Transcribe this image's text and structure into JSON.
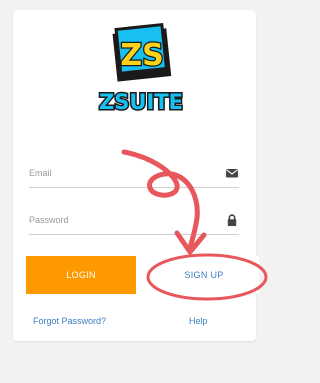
{
  "brand": {
    "logo_initials": "ZS",
    "logo_name": "ZSUITE"
  },
  "form": {
    "email_placeholder": "Email",
    "password_placeholder": "Password",
    "email_icon": "envelope-icon",
    "password_icon": "lock-icon"
  },
  "buttons": {
    "login_label": "LOGIN",
    "signup_label": "SIGN UP"
  },
  "links": {
    "forgot_password": "Forgot Password?",
    "help": "Help"
  },
  "colors": {
    "accent": "#ff9900",
    "link": "#3a7ec2",
    "annotation": "#e8575c",
    "background": "#f2f2f2"
  }
}
